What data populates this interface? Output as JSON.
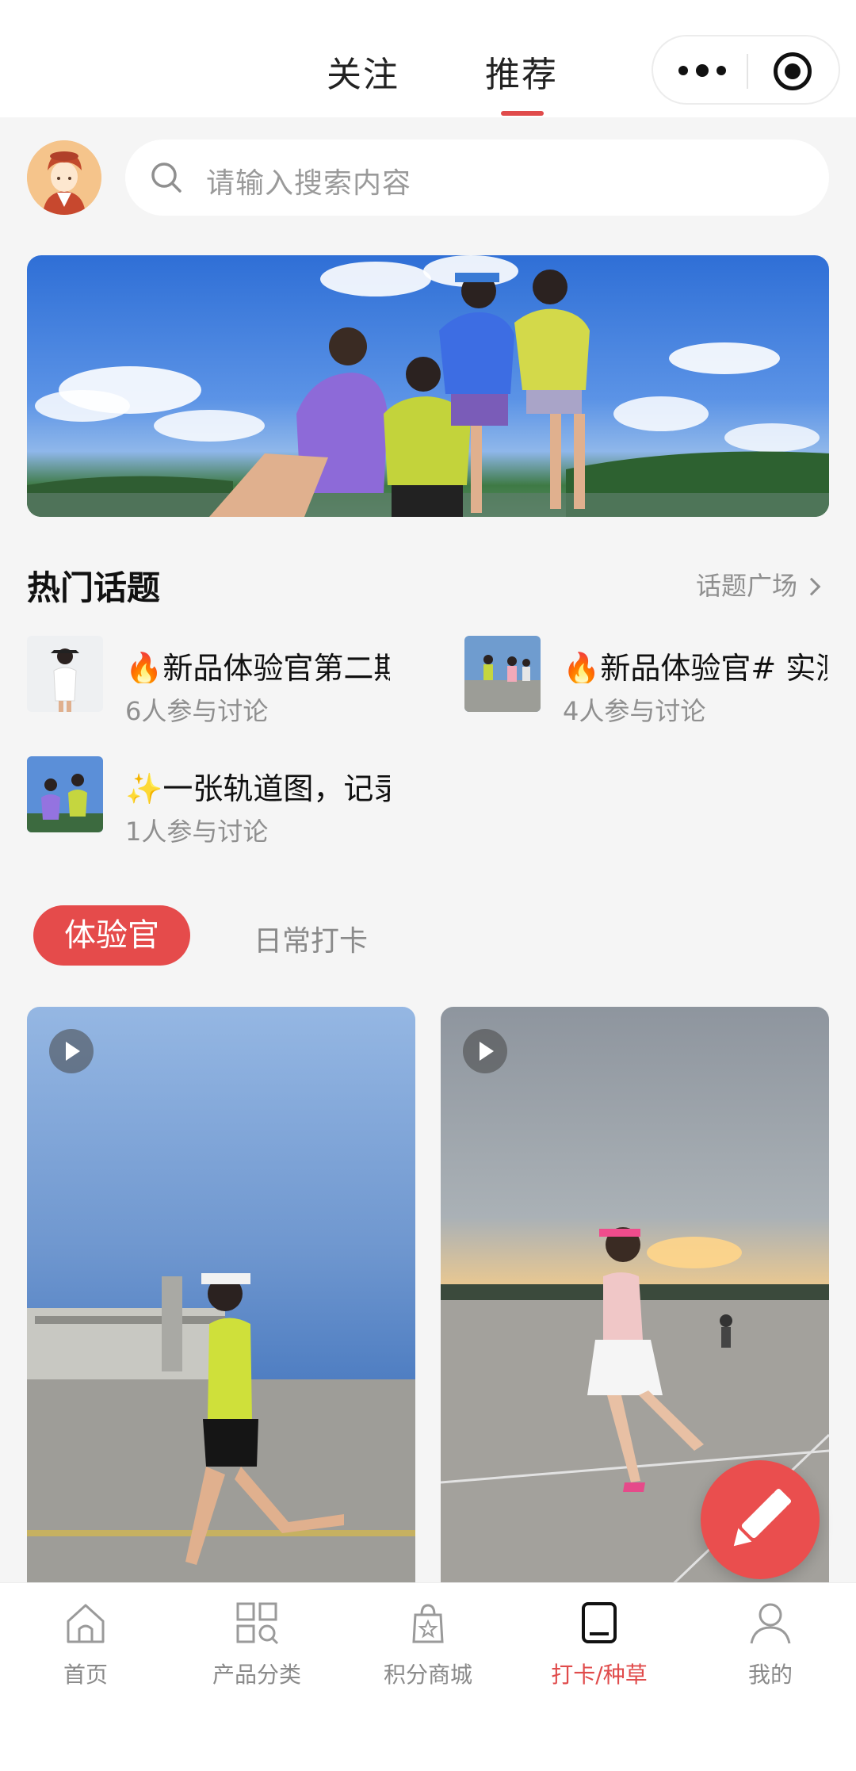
{
  "header": {
    "tabs": [
      {
        "label": "关注",
        "active": false
      },
      {
        "label": "推荐",
        "active": true
      }
    ],
    "accent_color": "#e04b4b"
  },
  "search": {
    "placeholder": "请输入搜索内容"
  },
  "hot_topics": {
    "title": "热门话题",
    "more_label": "话题广场",
    "items": [
      {
        "title": "🔥新品体验官第二期",
        "participants": "6人参与讨论"
      },
      {
        "title": "🔥新品体验官# 实测",
        "participants": "4人参与讨论"
      },
      {
        "title": "✨一张轨道图，记录",
        "participants": "1人参与讨论"
      }
    ]
  },
  "feed_tabs": [
    {
      "label": "体验官",
      "active": true
    },
    {
      "label": "日常打卡",
      "active": false
    }
  ],
  "bottom_nav": [
    {
      "label": "首页",
      "icon": "home-icon",
      "active": false
    },
    {
      "label": "产品分类",
      "icon": "category-icon",
      "active": false
    },
    {
      "label": "积分商城",
      "icon": "points-mall-icon",
      "active": false
    },
    {
      "label": "打卡/种草",
      "icon": "checkin-icon",
      "active": true
    },
    {
      "label": "我的",
      "icon": "profile-icon",
      "active": false
    }
  ]
}
